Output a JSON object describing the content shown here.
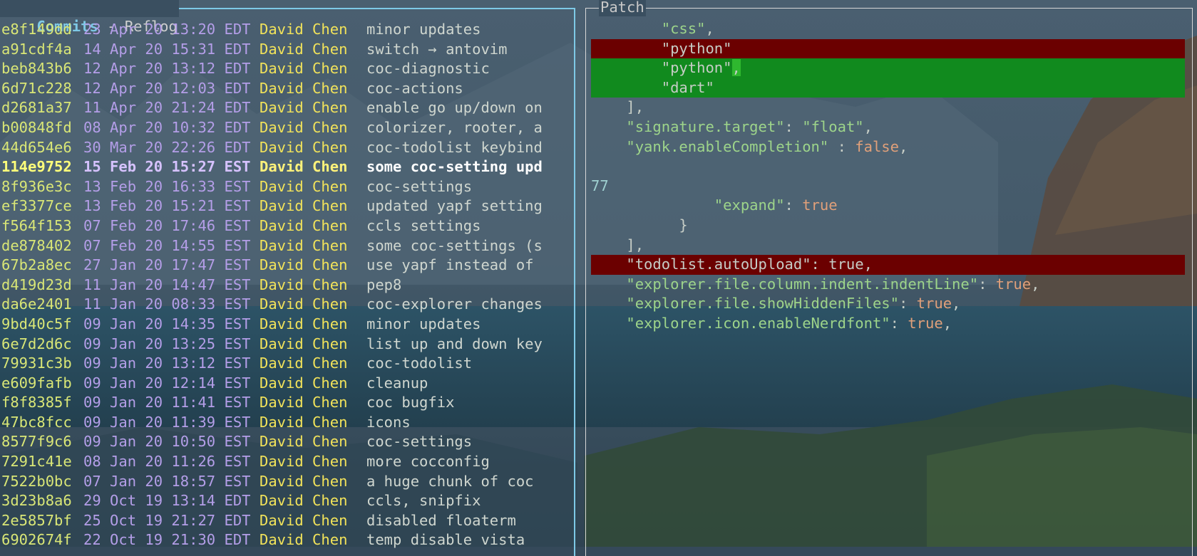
{
  "panes": {
    "commits": {
      "title_active": "Commits",
      "separator": " - ",
      "title_inactive": "Reflog"
    },
    "patch": {
      "title": "Patch"
    }
  },
  "commits": [
    {
      "hash": "e8f149dd",
      "date": "23 Apr 20 13:20 EDT",
      "author": "David Chen",
      "message": "minor updates"
    },
    {
      "hash": "a91cdf4a",
      "date": "14 Apr 20 15:31 EDT",
      "author": "David Chen",
      "message": "switch → antovim"
    },
    {
      "hash": "beb843b6",
      "date": "12 Apr 20 13:12 EDT",
      "author": "David Chen",
      "message": "coc-diagnostic"
    },
    {
      "hash": "6d71c228",
      "date": "12 Apr 20 12:03 EDT",
      "author": "David Chen",
      "message": "coc-actions"
    },
    {
      "hash": "d2681a37",
      "date": "11 Apr 20 21:24 EDT",
      "author": "David Chen",
      "message": "enable go up/down on"
    },
    {
      "hash": "b00848fd",
      "date": "08 Apr 20 10:32 EDT",
      "author": "David Chen",
      "message": "colorizer, rooter, a"
    },
    {
      "hash": "44d654e6",
      "date": "30 Mar 20 22:26 EDT",
      "author": "David Chen",
      "message": "coc-todolist keybind"
    },
    {
      "hash": "114e9752",
      "date": "15 Feb 20 15:27 EST",
      "author": "David Chen",
      "message": "some coc-setting upd"
    },
    {
      "hash": "8f936e3c",
      "date": "13 Feb 20 16:33 EST",
      "author": "David Chen",
      "message": "coc-settings"
    },
    {
      "hash": "ef3377ce",
      "date": "13 Feb 20 15:21 EST",
      "author": "David Chen",
      "message": "updated yapf setting"
    },
    {
      "hash": "f564f153",
      "date": "07 Feb 20 17:46 EST",
      "author": "David Chen",
      "message": "ccls settings"
    },
    {
      "hash": "de878402",
      "date": "07 Feb 20 14:55 EST",
      "author": "David Chen",
      "message": "some coc-settings (s"
    },
    {
      "hash": "67b2a8ec",
      "date": "27 Jan 20 17:47 EST",
      "author": "David Chen",
      "message": "use yapf instead of"
    },
    {
      "hash": "d419d23d",
      "date": "11 Jan 20 14:47 EST",
      "author": "David Chen",
      "message": "pep8"
    },
    {
      "hash": "da6e2401",
      "date": "11 Jan 20 08:33 EST",
      "author": "David Chen",
      "message": "coc-explorer changes"
    },
    {
      "hash": "9bd40c5f",
      "date": "09 Jan 20 14:35 EST",
      "author": "David Chen",
      "message": "minor updates"
    },
    {
      "hash": "6e7d2d6c",
      "date": "09 Jan 20 13:25 EST",
      "author": "David Chen",
      "message": "list up and down key"
    },
    {
      "hash": "79931c3b",
      "date": "09 Jan 20 13:12 EST",
      "author": "David Chen",
      "message": "coc-todolist"
    },
    {
      "hash": "e609fafb",
      "date": "09 Jan 20 12:14 EST",
      "author": "David Chen",
      "message": "cleanup"
    },
    {
      "hash": "f8f8385f",
      "date": "09 Jan 20 11:41 EST",
      "author": "David Chen",
      "message": "coc bugfix"
    },
    {
      "hash": "47bc8fcc",
      "date": "09 Jan 20 11:39 EST",
      "author": "David Chen",
      "message": "icons"
    },
    {
      "hash": "8577f9c6",
      "date": "09 Jan 20 10:50 EST",
      "author": "David Chen",
      "message": "coc-settings"
    },
    {
      "hash": "7291c41e",
      "date": "08 Jan 20 11:26 EST",
      "author": "David Chen",
      "message": "more cocconfig"
    },
    {
      "hash": "7522b0bc",
      "date": "07 Jan 20 18:57 EST",
      "author": "David Chen",
      "message": "a huge chunk of coc"
    },
    {
      "hash": "3d23b8a6",
      "date": "29 Oct 19 13:14 EDT",
      "author": "David Chen",
      "message": "ccls, snipfix"
    },
    {
      "hash": "2e5857bf",
      "date": "25 Oct 19 21:27 EDT",
      "author": "David Chen",
      "message": "disabled floaterm"
    },
    {
      "hash": "6902674f",
      "date": "22 Oct 19 21:30 EDT",
      "author": "David Chen",
      "message": "temp disable vista"
    }
  ],
  "selected_commit_index": 7,
  "patch_lines": [
    {
      "type": "ctx",
      "indent": "        ",
      "parts": [
        {
          "t": "\"css\"",
          "c": "k"
        },
        {
          "t": ",",
          "c": ""
        }
      ]
    },
    {
      "type": "del",
      "indent": "        ",
      "parts": [
        {
          "t": "\"python\"",
          "c": ""
        }
      ]
    },
    {
      "type": "add",
      "indent": "        ",
      "parts": [
        {
          "t": "\"python\"",
          "c": ""
        },
        {
          "t": ",",
          "c": "comma-hl"
        }
      ]
    },
    {
      "type": "add",
      "indent": "        ",
      "parts": [
        {
          "t": "\"dart\"",
          "c": ""
        }
      ]
    },
    {
      "type": "ctx",
      "indent": "    ",
      "parts": [
        {
          "t": "],",
          "c": ""
        }
      ]
    },
    {
      "type": "ctx",
      "indent": "    ",
      "parts": [
        {
          "t": "\"signature.target\"",
          "c": "k"
        },
        {
          "t": ": ",
          "c": ""
        },
        {
          "t": "\"float\"",
          "c": "k"
        },
        {
          "t": ",",
          "c": ""
        }
      ]
    },
    {
      "type": "ctx",
      "indent": "    ",
      "parts": [
        {
          "t": "\"yank.enableCompletion\"",
          "c": "k"
        },
        {
          "t": " : ",
          "c": ""
        },
        {
          "t": "false",
          "c": "v"
        },
        {
          "t": ",",
          "c": ""
        }
      ]
    },
    {
      "type": "ctx",
      "indent": "",
      "parts": []
    },
    {
      "type": "ctx",
      "indent": "",
      "parts": [
        {
          "t": "77",
          "c": "num"
        }
      ]
    },
    {
      "type": "ctx",
      "indent": "              ",
      "parts": [
        {
          "t": "\"expand\"",
          "c": "k"
        },
        {
          "t": ": ",
          "c": ""
        },
        {
          "t": "true",
          "c": "v"
        }
      ]
    },
    {
      "type": "ctx",
      "indent": "          ",
      "parts": [
        {
          "t": "}",
          "c": ""
        }
      ]
    },
    {
      "type": "ctx",
      "indent": "    ",
      "parts": [
        {
          "t": "],",
          "c": ""
        }
      ]
    },
    {
      "type": "del",
      "indent": "    ",
      "parts": [
        {
          "t": "\"todolist.autoUpload\": true,",
          "c": ""
        }
      ]
    },
    {
      "type": "ctx",
      "indent": "    ",
      "parts": [
        {
          "t": "\"explorer.file.column.indent.indentLine\"",
          "c": "k"
        },
        {
          "t": ": ",
          "c": ""
        },
        {
          "t": "true",
          "c": "v"
        },
        {
          "t": ",",
          "c": ""
        }
      ]
    },
    {
      "type": "ctx",
      "indent": "    ",
      "parts": [
        {
          "t": "\"explorer.file.showHiddenFiles\"",
          "c": "k"
        },
        {
          "t": ": ",
          "c": ""
        },
        {
          "t": "true",
          "c": "v"
        },
        {
          "t": ",",
          "c": ""
        }
      ]
    },
    {
      "type": "ctx",
      "indent": "    ",
      "parts": [
        {
          "t": "\"explorer.icon.enableNerdfont\"",
          "c": "k"
        },
        {
          "t": ": ",
          "c": ""
        },
        {
          "t": "true",
          "c": "v"
        },
        {
          "t": ",",
          "c": ""
        }
      ]
    }
  ],
  "colors": {
    "commits_border": "#7ec9e6",
    "hash": "#d9e676",
    "date": "#b49ee8",
    "author": "#f2e35a",
    "diff_deleted": "#6b0000",
    "diff_added": "#118a1e"
  }
}
